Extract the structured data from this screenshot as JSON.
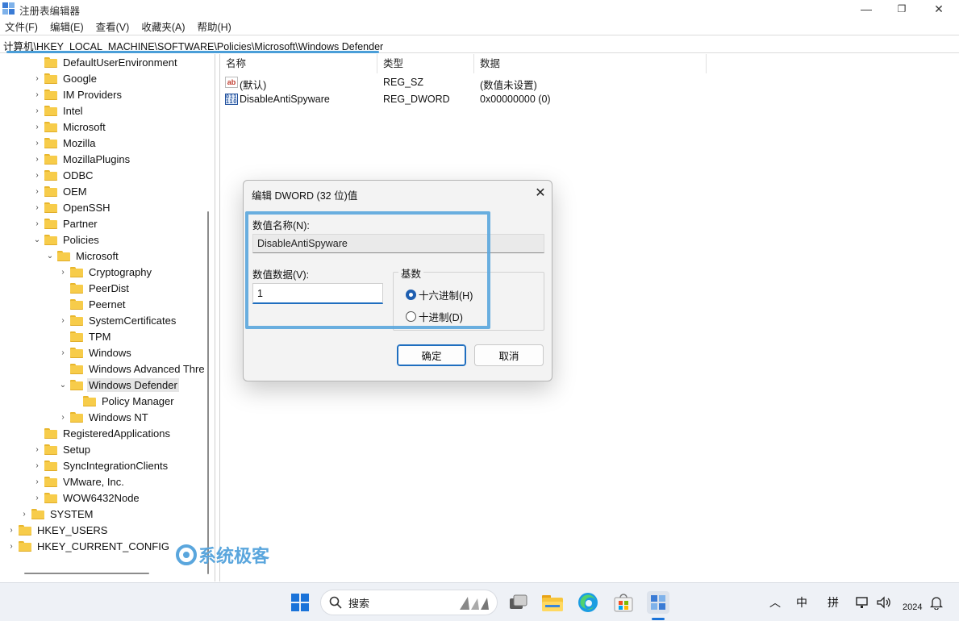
{
  "app": {
    "title": "注册表编辑器",
    "minimize": "—",
    "restore": "❐",
    "close": "✕"
  },
  "menu": [
    {
      "label": "文件(F)"
    },
    {
      "label": "编辑(E)"
    },
    {
      "label": "查看(V)"
    },
    {
      "label": "收藏夹(A)"
    },
    {
      "label": "帮助(H)"
    }
  ],
  "address": "计算机\\HKEY_LOCAL_MACHINE\\SOFTWARE\\Policies\\Microsoft\\Windows Defender",
  "tree": [
    {
      "label": "DefaultUserEnvironment",
      "twisty": ""
    },
    {
      "label": "Google",
      "twisty": "›"
    },
    {
      "label": "IM Providers",
      "twisty": "›"
    },
    {
      "label": "Intel",
      "twisty": "›"
    },
    {
      "label": "Microsoft",
      "twisty": "›"
    },
    {
      "label": "Mozilla",
      "twisty": "›"
    },
    {
      "label": "MozillaPlugins",
      "twisty": "›"
    },
    {
      "label": "ODBC",
      "twisty": "›"
    },
    {
      "label": "OEM",
      "twisty": "›"
    },
    {
      "label": "OpenSSH",
      "twisty": "›"
    },
    {
      "label": "Partner",
      "twisty": "›"
    },
    {
      "label": "Policies",
      "twisty": "⌄"
    },
    {
      "label": "Microsoft",
      "twisty": "⌄"
    },
    {
      "label": "Cryptography",
      "twisty": "›"
    },
    {
      "label": "PeerDist",
      "twisty": ""
    },
    {
      "label": "Peernet",
      "twisty": ""
    },
    {
      "label": "SystemCertificates",
      "twisty": "›"
    },
    {
      "label": "TPM",
      "twisty": ""
    },
    {
      "label": "Windows",
      "twisty": "›"
    },
    {
      "label": "Windows Advanced Thre",
      "twisty": ""
    },
    {
      "label": "Windows Defender",
      "twisty": "⌄"
    },
    {
      "label": "Policy Manager",
      "twisty": ""
    },
    {
      "label": "Windows NT",
      "twisty": "›"
    },
    {
      "label": "RegisteredApplications",
      "twisty": ""
    },
    {
      "label": "Setup",
      "twisty": "›"
    },
    {
      "label": "SyncIntegrationClients",
      "twisty": "›"
    },
    {
      "label": "VMware, Inc.",
      "twisty": "›"
    },
    {
      "label": "WOW6432Node",
      "twisty": "›"
    },
    {
      "label": "SYSTEM",
      "twisty": "›"
    },
    {
      "label": "HKEY_USERS",
      "twisty": "›"
    },
    {
      "label": "HKEY_CURRENT_CONFIG",
      "twisty": "›"
    }
  ],
  "values": {
    "columns": {
      "name": "名称",
      "type": "类型",
      "data": "数据"
    },
    "rows": [
      {
        "icon": "ab",
        "name": "(默认)",
        "type": "REG_SZ",
        "data": "(数值未设置)"
      },
      {
        "icon": "011\n110",
        "name": "DisableAntiSpyware",
        "type": "REG_DWORD",
        "data": "0x00000000 (0)"
      }
    ]
  },
  "dialog": {
    "title": "编辑 DWORD (32 位)值",
    "close_glyph": "✕",
    "name_label": "数值名称(N):",
    "name_value": "DisableAntiSpyware",
    "data_label": "数值数据(V):",
    "data_value": "1",
    "base_label": "基数",
    "hex_label": "十六进制(H)",
    "dec_label": "十进制(D)",
    "selected_base": "hex",
    "ok": "确定",
    "cancel": "取消"
  },
  "watermark": "系统极客",
  "taskbar": {
    "search_placeholder": "搜索",
    "tray_chevron": "︿",
    "ime_lang": "中",
    "ime_mode": "拼",
    "clock": "2024"
  },
  "colors": {
    "accent": "#1f6ebf",
    "highlight": "#5aa6dd",
    "folder": "#f7cc4a"
  }
}
